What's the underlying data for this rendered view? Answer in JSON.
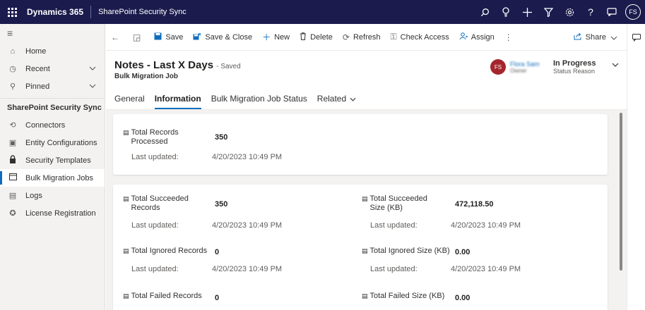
{
  "topbar": {
    "brand": "Dynamics 365",
    "app_name": "SharePoint Security Sync",
    "user_initials": "FS",
    "icons": [
      "search-icon",
      "lightbulb-icon",
      "add-icon",
      "filter-icon",
      "settings-icon",
      "help-icon",
      "chat-icon"
    ]
  },
  "sidebar": {
    "items": [
      {
        "label": "Home",
        "icon": "home-icon"
      },
      {
        "label": "Recent",
        "icon": "clock-icon"
      },
      {
        "label": "Pinned",
        "icon": "pin-icon"
      }
    ],
    "section_title": "SharePoint Security Sync",
    "section_items": [
      {
        "label": "Connectors",
        "icon": "connector-icon"
      },
      {
        "label": "Entity Configurations",
        "icon": "entity-icon"
      },
      {
        "label": "Security Templates",
        "icon": "lock-icon"
      },
      {
        "label": "Bulk Migration Jobs",
        "icon": "job-icon"
      },
      {
        "label": "Logs",
        "icon": "log-icon"
      },
      {
        "label": "License Registration",
        "icon": "license-icon"
      }
    ]
  },
  "commands": {
    "save": "Save",
    "save_close": "Save & Close",
    "new": "New",
    "delete": "Delete",
    "refresh": "Refresh",
    "check_access": "Check Access",
    "assign": "Assign",
    "share": "Share"
  },
  "record": {
    "title": "Notes - Last X Days",
    "saved_state": "- Saved",
    "entity": "Bulk Migration Job",
    "owner_initials": "FS",
    "owner_name": "Flora Sam",
    "owner_role": "Owner",
    "status_value": "In Progress",
    "status_label": "Status Reason"
  },
  "tabs": [
    "General",
    "Information",
    "Bulk Migration Job Status",
    "Related"
  ],
  "fields": {
    "last_updated_label": "Last updated:",
    "total_processed": {
      "label": "Total Records Processed",
      "value": "350",
      "updated": "4/20/2023 10:49 PM"
    },
    "total_succeeded": {
      "label": "Total Succeeded Records",
      "value": "350",
      "updated": "4/20/2023 10:49 PM"
    },
    "total_succeeded_size": {
      "label": "Total Succeeded Size (KB)",
      "value": "472,118.50",
      "updated": "4/20/2023 10:49 PM"
    },
    "total_ignored": {
      "label": "Total Ignored Records",
      "value": "0",
      "updated": "4/20/2023 10:49 PM"
    },
    "total_ignored_size": {
      "label": "Total Ignored Size (KB)",
      "value": "0.00",
      "updated": "4/20/2023 10:49 PM"
    },
    "total_failed": {
      "label": "Total Failed Records",
      "value": "0"
    },
    "total_failed_size": {
      "label": "Total Failed Size (KB)",
      "value": "0.00"
    }
  }
}
